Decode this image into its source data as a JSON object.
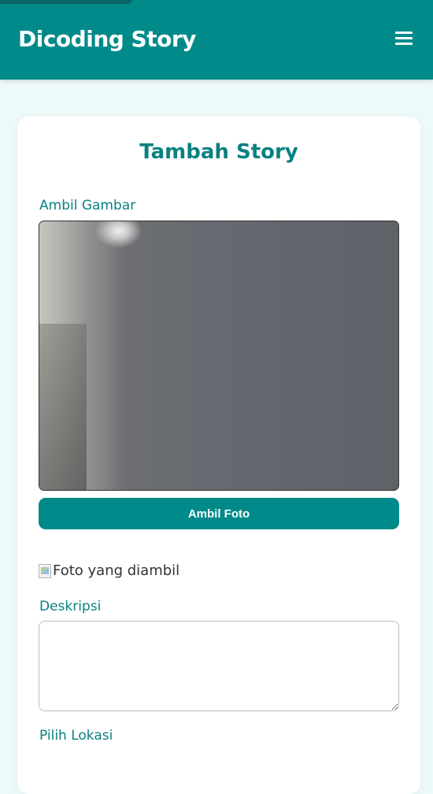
{
  "header": {
    "title": "Dicoding Story",
    "menu_icon": "hamburger-menu-icon"
  },
  "form": {
    "title": "Tambah Story",
    "camera_label": "Ambil Gambar",
    "capture_button": "Ambil Foto",
    "photo_alt": "Foto yang diambil",
    "description_label": "Deskripsi",
    "description_value": "",
    "location_label": "Pilih Lokasi"
  },
  "colors": {
    "primary": "#008a8a",
    "background": "#eefafa",
    "card": "#ffffff"
  }
}
